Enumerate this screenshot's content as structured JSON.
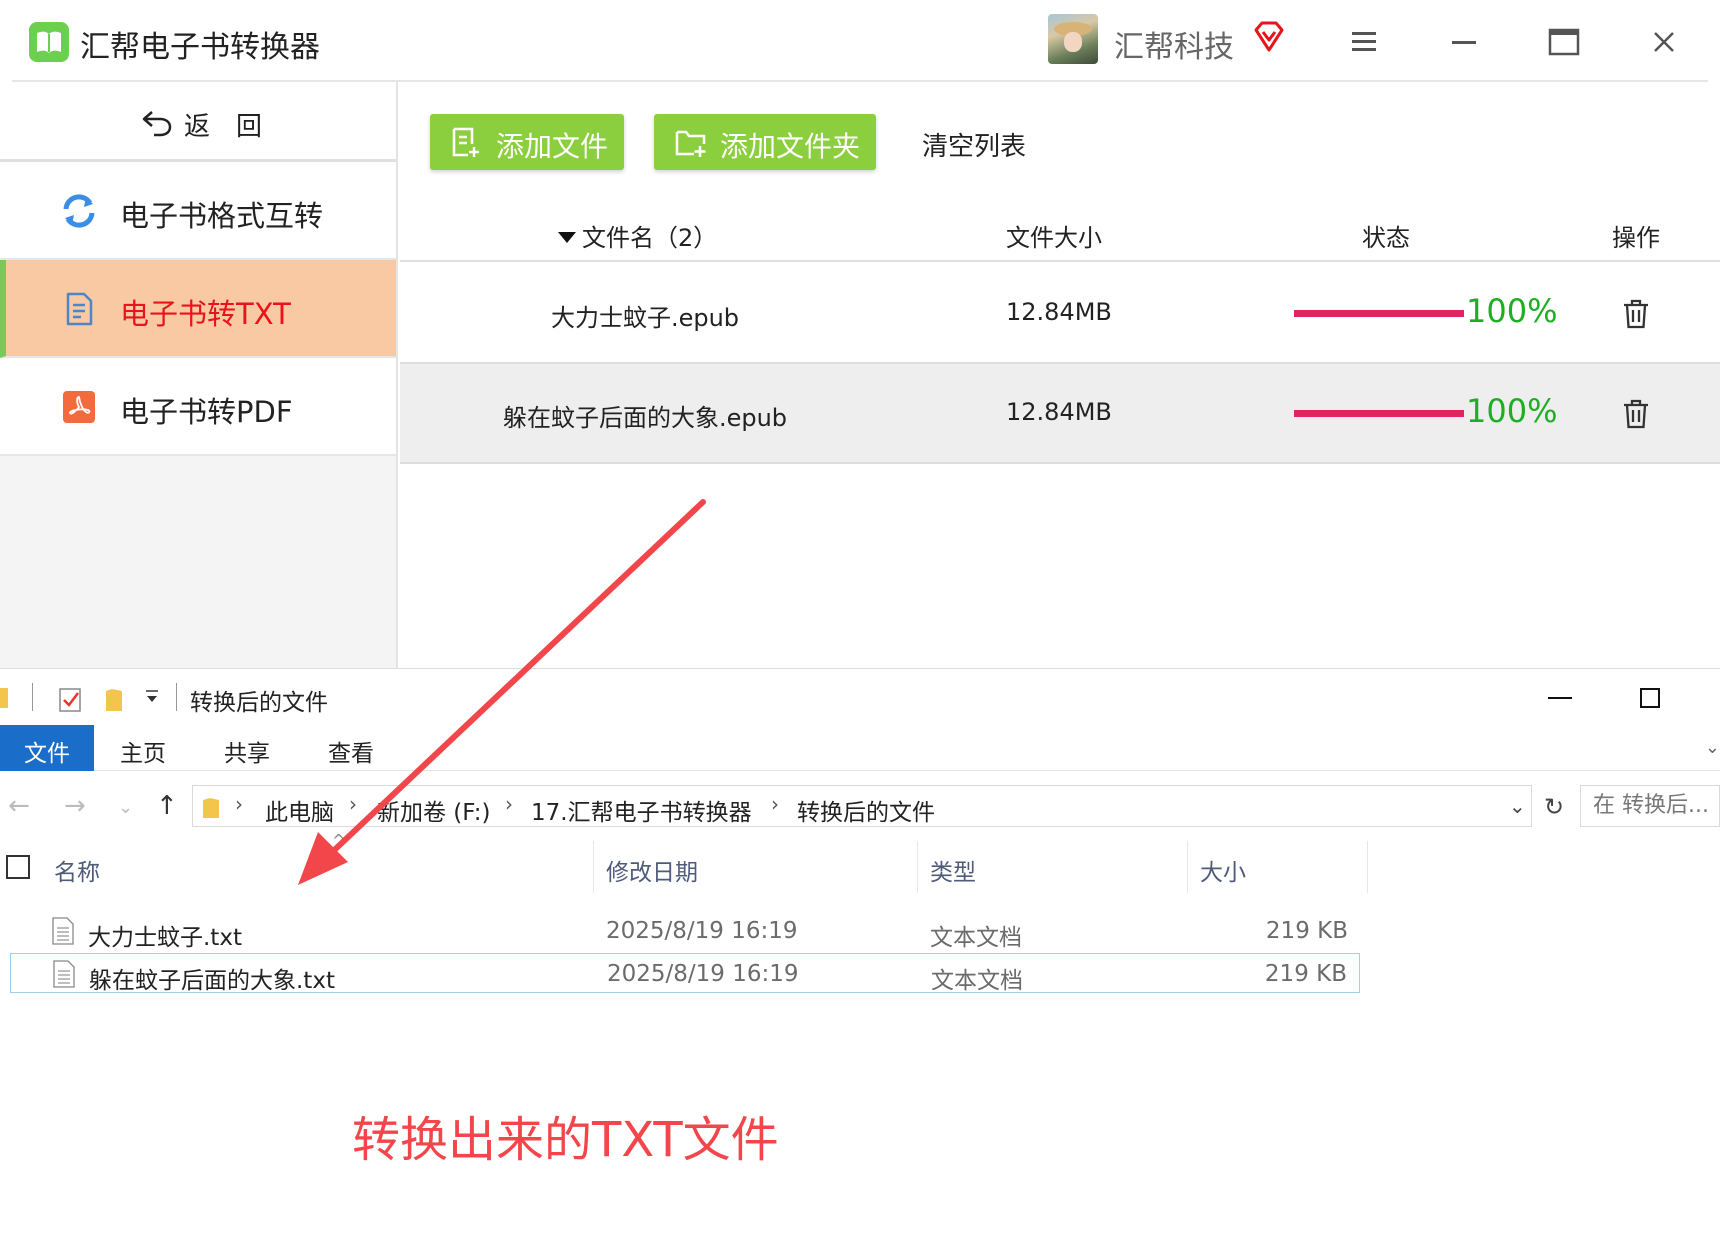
{
  "app": {
    "title": "汇帮电子书转换器",
    "user_name": "汇帮科技"
  },
  "sidebar": {
    "back_label": "返回",
    "items": [
      {
        "label": "电子书格式互转",
        "icon": "refresh-icon",
        "active": false
      },
      {
        "label": "电子书转TXT",
        "icon": "document-icon",
        "active": true
      },
      {
        "label": "电子书转PDF",
        "icon": "pdf-icon",
        "active": false
      }
    ]
  },
  "toolbar": {
    "add_file_label": "添加文件",
    "add_folder_label": "添加文件夹",
    "clear_label": "清空列表"
  },
  "table": {
    "headers": {
      "name": "文件名（2）",
      "size": "文件大小",
      "status": "状态",
      "operation": "操作"
    },
    "rows": [
      {
        "name": "大力士蚊子.epub",
        "size": "12.84MB",
        "progress": 100,
        "progress_label": "100%"
      },
      {
        "name": "躲在蚊子后面的大象.epub",
        "size": "12.84MB",
        "progress": 100,
        "progress_label": "100%"
      }
    ]
  },
  "explorer": {
    "title": "转换后的文件",
    "ribbon": {
      "file": "文件",
      "home": "主页",
      "share": "共享",
      "view": "查看"
    },
    "breadcrumb": [
      "此电脑",
      "新加卷 (F:)",
      "17.汇帮电子书转换器",
      "转换后的文件"
    ],
    "search_placeholder": "在 转换后...",
    "columns": {
      "name": "名称",
      "date": "修改日期",
      "type": "类型",
      "size": "大小"
    },
    "files": [
      {
        "name": "大力士蚊子.txt",
        "date": "2025/8/19 16:19",
        "type": "文本文档",
        "size": "219 KB",
        "selected": false
      },
      {
        "name": "躲在蚊子后面的大象.txt",
        "date": "2025/8/19 16:19",
        "type": "文本文档",
        "size": "219 KB",
        "selected": true
      }
    ]
  },
  "annotation": {
    "text": "转换出来的TXT文件"
  },
  "colors": {
    "accent_green": "#8ccf3e",
    "active_bg": "#f8c9a2",
    "active_text": "#e8131b",
    "progress": "#e3235f",
    "percent": "#1fae23",
    "explorer_file_tab": "#1a6dc8",
    "annotation": "#f2464b"
  }
}
